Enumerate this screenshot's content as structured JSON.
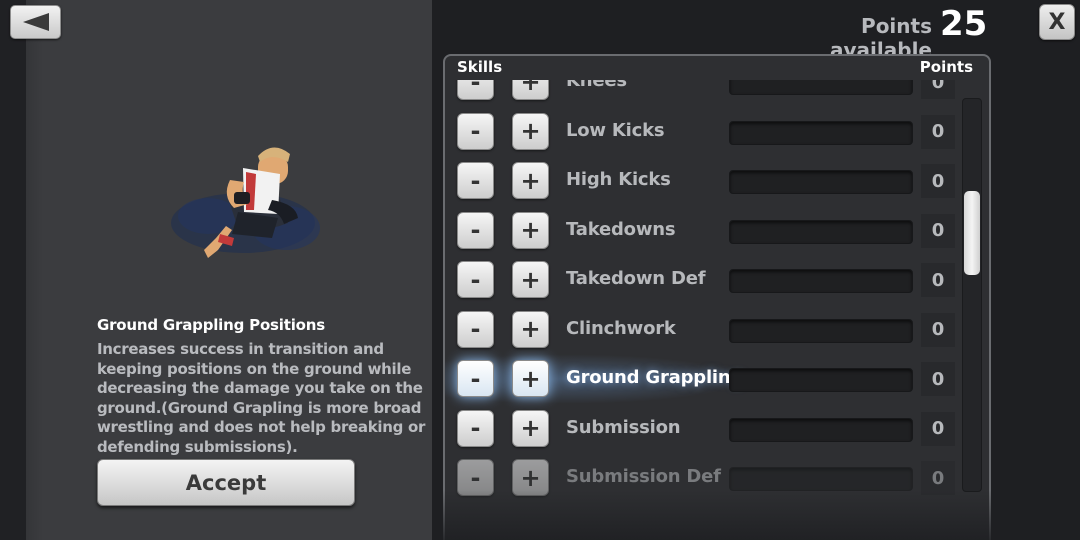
{
  "header": {
    "points_label": "Points available",
    "points_value": "25",
    "close_label": "X"
  },
  "detail": {
    "title": "Ground Grappling Positions",
    "description": "Increases success in transition and keeping positions on the ground while decreasing the damage you take on the ground.(Ground Grapling is more broad wrestling and does not help breaking or defending submissions).",
    "accept_label": "Accept"
  },
  "skills": {
    "column_skills": "Skills",
    "column_points": "Points",
    "minus_symbol": "-",
    "plus_symbol": "+",
    "rows": [
      {
        "label": "Knees",
        "points": "0"
      },
      {
        "label": "Low Kicks",
        "points": "0"
      },
      {
        "label": "High Kicks",
        "points": "0"
      },
      {
        "label": "Takedowns",
        "points": "0"
      },
      {
        "label": "Takedown Def",
        "points": "0"
      },
      {
        "label": "Clinchwork",
        "points": "0"
      },
      {
        "label": "Ground Grappling",
        "points": "0"
      },
      {
        "label": "Submission",
        "points": "0"
      },
      {
        "label": "Submission Def",
        "points": "0"
      }
    ],
    "selected_index": 6,
    "scroll_position": 0.3
  },
  "icons": {
    "back": "back-arrow-icon",
    "close": "close-icon",
    "fighter": "fighter-grappling-illustration"
  }
}
